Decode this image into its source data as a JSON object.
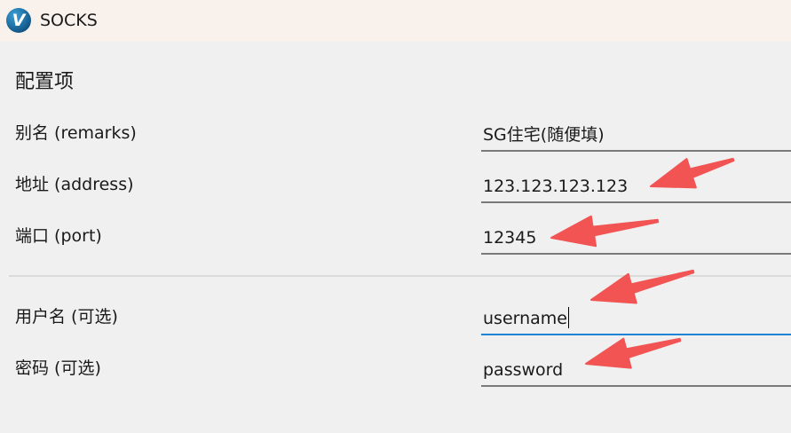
{
  "window": {
    "title": "SOCKS",
    "logo_letter": "V",
    "logo_icon": "v2ray-logo-icon"
  },
  "form": {
    "section_title": "配置项",
    "fields": [
      {
        "label": "别名 (remarks)",
        "value": "SG住宅(随便填)",
        "focused": false
      },
      {
        "label": "地址 (address)",
        "value": "123.123.123.123",
        "focused": false
      },
      {
        "label": "端口 (port)",
        "value": "12345",
        "focused": false
      },
      {
        "label": "用户名 (可选)",
        "value": "username",
        "focused": true
      },
      {
        "label": "密码 (可选)",
        "value": "password",
        "focused": false
      }
    ]
  },
  "annotations": {
    "arrow_color": "#f25454",
    "arrow_count": 5
  },
  "colors": {
    "titlebar": "#f8f1ec",
    "background": "#f0f0f0",
    "field_underline": "#7a7a7a",
    "focus_underline": "#1f84d6"
  }
}
